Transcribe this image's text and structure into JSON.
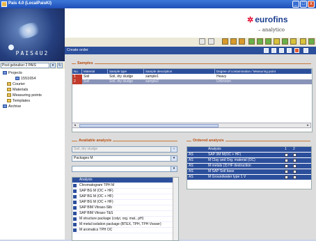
{
  "window": {
    "title": "Pais 4.0 (LocalPaisKl)",
    "controls": [
      "_",
      "□",
      "x"
    ]
  },
  "left": {
    "logo": "PAIS4U2",
    "selector_value": "Post gebruiker 2 PAIS",
    "tree": [
      {
        "label": "Projects"
      },
      {
        "label": "1551654"
      },
      {
        "label": "Courier"
      },
      {
        "label": "Materials"
      },
      {
        "label": "Measuring points"
      },
      {
        "label": "Templates"
      },
      {
        "label": "Archive"
      }
    ]
  },
  "header": {
    "brand": "eurofins",
    "sub": "– analytico"
  },
  "toolbar": {
    "screen_title": "Create order"
  },
  "samples": {
    "title": "Samples",
    "columns": [
      "No.",
      "Material",
      "Sample type",
      "Sample description",
      "Degree of contamination",
      "Measuring point"
    ],
    "rows": [
      {
        "no": "1",
        "material": "Soil",
        "type": "Soil, dry sludge",
        "desc": "sample1",
        "degree": "Heavy",
        "point": ""
      },
      {
        "no": "2",
        "material": "Soil",
        "type": "Soil, dry sludge",
        "desc": "sample2",
        "degree": "Unknown",
        "point": ""
      }
    ]
  },
  "available": {
    "title": "Available analysis",
    "sample_type": "Soil, dry sludge",
    "package": "Packages M",
    "search": "",
    "column": "Analysis",
    "items": [
      "Chromatogram TPH M",
      "SAP BG M (OC + HF)",
      "SAP BG M (OC + HF)",
      "SAP BG M (OC + HF)",
      "SAP BIM Vitraso-Slib",
      "SAP BIM Vitraso-T&S",
      "M structure package (cotyr, org. mat., pH)",
      "M metal isolation package (BTEX, TPH, TPH Vosser)",
      "M aromatics TPH OC"
    ]
  },
  "ordered": {
    "title": "Ordered analysis",
    "columns": [
      "Analysis",
      "1",
      "2"
    ],
    "rows": [
      {
        "tag": "AS",
        "name": "SAP 3M M(OC + HF)",
        "c1": true,
        "c2": true
      },
      {
        "tag": "AS",
        "name": "M Clay and Org. material (OC)",
        "c1": true,
        "c2": false
      },
      {
        "tag": "AS",
        "name": "M metals (3) HF destruction",
        "c1": true,
        "c2": true
      },
      {
        "tag": "AS",
        "name": "M SAP Soil base",
        "c1": true,
        "c2": false
      },
      {
        "tag": "AS",
        "name": "M Groundwater type 1 V",
        "c1": true,
        "c2": false
      }
    ]
  }
}
